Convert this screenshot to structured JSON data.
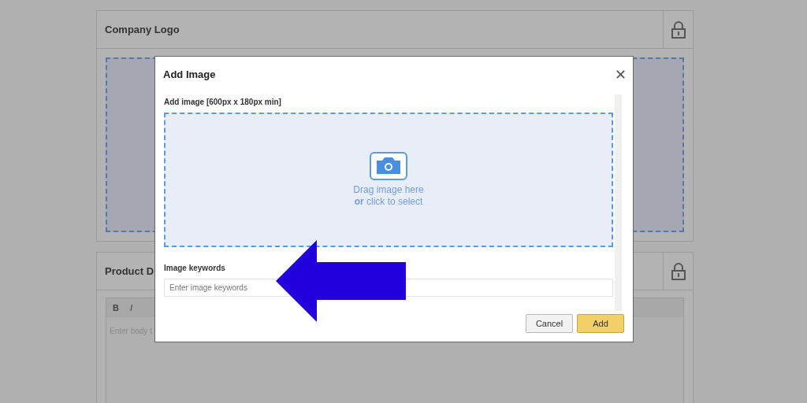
{
  "background": {
    "panels": [
      {
        "title": "Company Logo",
        "kind": "image"
      },
      {
        "title": "Product D",
        "kind": "editor",
        "toolbar": [
          "B",
          "I"
        ],
        "placeholder": "Enter body t"
      }
    ]
  },
  "dialog": {
    "title": "Add Image",
    "close": "✕",
    "image_label": "Add image [600px x 180px min]",
    "drop_text": "Drag image here",
    "drop_text_2": "**or** click to select",
    "keywords_label": "Image keywords",
    "keywords_placeholder": "Enter image keywords",
    "buttons": [
      {
        "label": "Cancel",
        "kind": "secondary"
      },
      {
        "label": "Add",
        "kind": "primary"
      }
    ]
  }
}
